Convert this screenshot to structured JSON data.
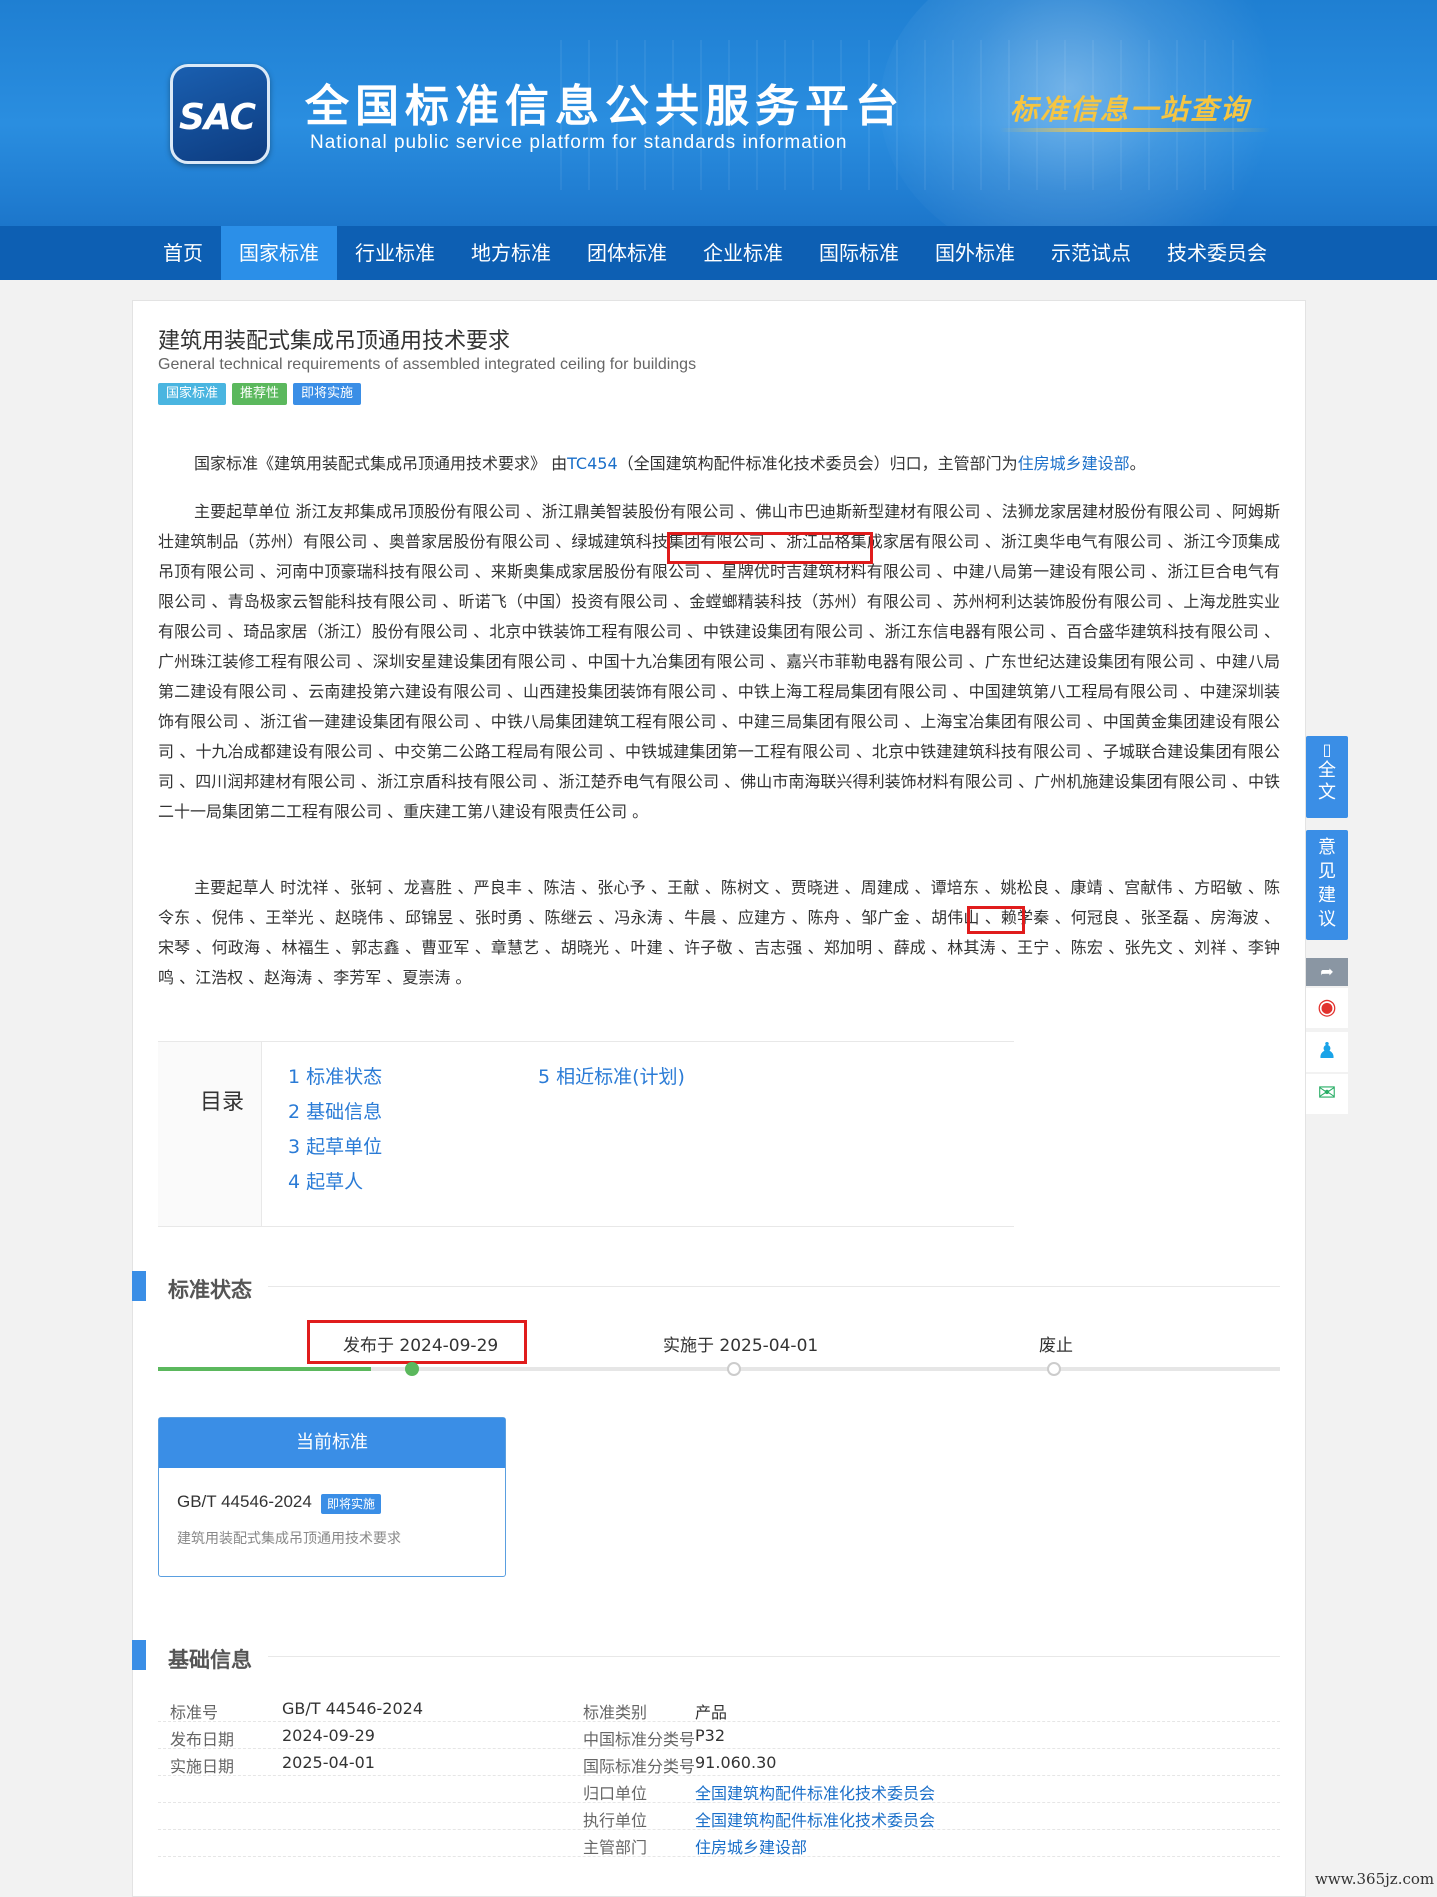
{
  "header": {
    "logo_text": "SAC",
    "title": "全国标准信息公共服务平台",
    "subtitle": "National public service platform  for standards information",
    "slogan": "标准信息一站查询"
  },
  "nav": {
    "items": [
      "首页",
      "国家标准",
      "行业标准",
      "地方标准",
      "团体标准",
      "企业标准",
      "国际标准",
      "国外标准",
      "示范试点",
      "技术委员会"
    ],
    "active_index": 1
  },
  "standard": {
    "title": "建筑用装配式集成吊顶通用技术要求",
    "title_en": "General technical requirements of assembled integrated ceiling for buildings",
    "badges": [
      "国家标准",
      "推荐性",
      "即将实施"
    ]
  },
  "intro": {
    "p1": "国家标准《建筑用装配式集成吊顶通用技术要求》 由",
    "tc_link": "TC454",
    "p2": "（全国建筑构配件标准化技术委员会）归口，主管部门为",
    "dept_link": "住房城乡建设部",
    "p3": "。"
  },
  "drafters": {
    "text": "主要起草单位 浙江友邦集成吊顶股份有限公司 、浙江鼎美智装股份有限公司 、佛山市巴迪斯新型建材有限公司 、法狮龙家居建材股份有限公司 、阿姆斯壮建筑制品（苏州）有限公司 、奥普家居股份有限公司 、绿城建筑科技集团有限公司 、浙江品格集成家居有限公司 、浙江奥华电气有限公司 、浙江今顶集成吊顶有限公司 、河南中顶豪瑞科技有限公司 、来斯奥集成家居股份有限公司 、星牌优时吉建筑材料有限公司 、中建八局第一建设有限公司 、浙江巨合电气有限公司 、青岛极家云智能科技有限公司 、昕诺飞（中国）投资有限公司 、金螳螂精装科技（苏州）有限公司 、苏州柯利达装饰股份有限公司 、上海龙胜实业有限公司 、琦品家居（浙江）股份有限公司 、北京中铁装饰工程有限公司 、中铁建设集团有限公司 、浙江东信电器有限公司 、百合盛华建筑科技有限公司 、广州珠江装修工程有限公司 、深圳安星建设集团有限公司 、中国十九冶集团有限公司 、嘉兴市菲勒电器有限公司 、广东世纪达建设集团有限公司 、中建八局第二建设有限公司 、云南建投第六建设有限公司 、山西建投集团装饰有限公司 、中铁上海工程局集团有限公司 、中国建筑第八工程局有限公司 、中建深圳装饰有限公司 、浙江省一建建设集团有限公司 、中铁八局集团建筑工程有限公司 、中建三局集团有限公司 、上海宝冶集团有限公司 、中国黄金集团建设有限公司 、十九冶成都建设有限公司 、中交第二公路工程局有限公司 、中铁城建集团第一工程有限公司 、北京中铁建建筑科技有限公司 、子城联合建设集团有限公司 、四川润邦建材有限公司 、浙江京盾科技有限公司 、浙江楚乔电气有限公司 、佛山市南海联兴得利装饰材料有限公司 、广州机施建设集团有限公司 、中铁二十一局集团第二工程有限公司 、重庆建工第八建设有限责任公司 。"
  },
  "authors": {
    "text": "主要起草人 时沈祥 、张轲 、龙喜胜 、严良丰 、陈洁 、张心予 、王献 、陈树文 、贾晓进 、周建成 、谭培东 、姚松良 、康靖 、宫献伟 、方昭敏 、陈令东 、倪伟 、王举光 、赵晓伟 、邱锦昱 、张时勇 、陈继云 、冯永涛 、牛晨 、应建方 、陈舟 、邹广金 、胡伟山 、赖学秦 、何冠良 、张圣磊 、房海波 、宋琴 、何政海 、林福生 、郭志鑫 、曹亚军 、章慧艺 、胡晓光 、叶建 、许子敬 、吉志强 、郑加明 、薛成 、林其涛 、王宁 、陈宏 、张先文 、刘祥 、李钟鸣 、江浩权 、赵海涛 、李芳军 、夏崇涛 。"
  },
  "toc": {
    "label": "目录",
    "items": [
      "1  标准状态",
      "2  基础信息",
      "3  起草单位",
      "4  起草人",
      "5  相近标准(计划)"
    ]
  },
  "status": {
    "section_title": "标准状态",
    "published": "发布于 2024-09-29",
    "implemented": "实施于 2025-04-01",
    "abolished": "废止",
    "progress_fraction": 0.19
  },
  "current": {
    "header": "当前标准",
    "code": "GB/T 44546-2024",
    "badge": "即将实施",
    "name": "建筑用装配式集成吊顶通用技术要求"
  },
  "basic": {
    "section_title": "基础信息",
    "rows": [
      {
        "l1": "标准号",
        "v1": "GB/T 44546-2024",
        "l2": "标准类别",
        "v2": "产品"
      },
      {
        "l1": "发布日期",
        "v1": "2024-09-29",
        "l2": "中国标准分类号",
        "v2": "P32"
      },
      {
        "l1": "实施日期",
        "v1": "2025-04-01",
        "l2": "国际标准分类号",
        "v2": "91.060.30"
      },
      {
        "l1": "",
        "v1": "",
        "l2": "归口单位",
        "v2": "全国建筑构配件标准化技术委员会"
      },
      {
        "l1": "",
        "v1": "",
        "l2": "执行单位",
        "v2": "全国建筑构配件标准化技术委员会"
      },
      {
        "l1": "",
        "v1": "",
        "l2": "主管部门",
        "v2": "住房城乡建设部"
      }
    ]
  },
  "floatbar": {
    "fulltext": "全文",
    "feedback": "意见建议",
    "icons": [
      "share-icon",
      "weibo-icon",
      "qq-icon",
      "wechat-icon"
    ]
  },
  "watermark": "www.365jz.com",
  "colors": {
    "header_blue": "#1f7fd2",
    "nav_blue": "#0d5fb3",
    "nav_active": "#2b8fe8",
    "accent": "#3a8ee6",
    "link": "#1a6fc9",
    "highlight_red": "#e01c1c",
    "progress_green": "#5bb85d"
  }
}
